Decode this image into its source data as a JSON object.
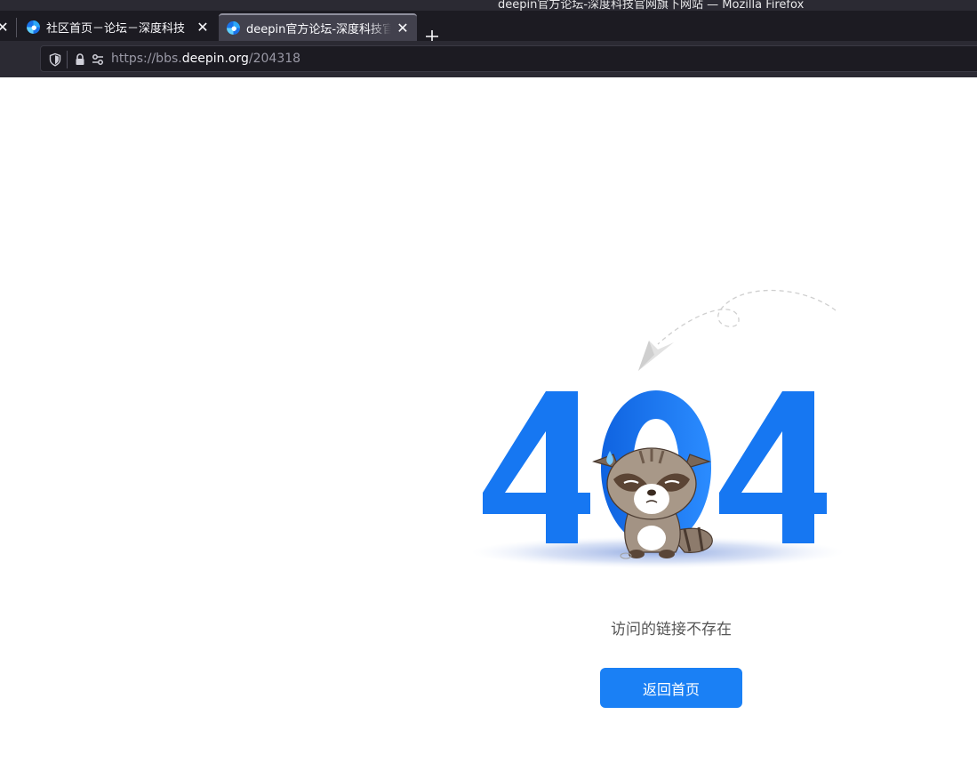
{
  "window": {
    "title": "deepin官方论坛-深度科技官网旗下网站 — Mozilla Firefox"
  },
  "tabs": [
    {
      "label": "社区首页－论坛－深度科技",
      "active": false
    },
    {
      "label": "deepin官方论坛-深度科技官网旗下网站",
      "active": true
    }
  ],
  "address_bar": {
    "scheme": "https://bbs.",
    "host": "deepin.org",
    "path": "/204318"
  },
  "error_page": {
    "code_text": "404",
    "message": "访问的链接不存在",
    "home_button": "返回首页"
  },
  "colors": {
    "accent": "#1a80f5",
    "code_blue": "#1677f2",
    "chrome_dark": "#1c1b22"
  },
  "icons": {
    "favicon": "deepin-logo-icon",
    "close": "close-icon",
    "new_tab": "plus-icon",
    "tracking": "shield-icon",
    "security": "lock-icon",
    "permissions": "permissions-icon",
    "paper_plane": "paper-plane-icon",
    "mascot": "raccoon-mascot-icon"
  }
}
